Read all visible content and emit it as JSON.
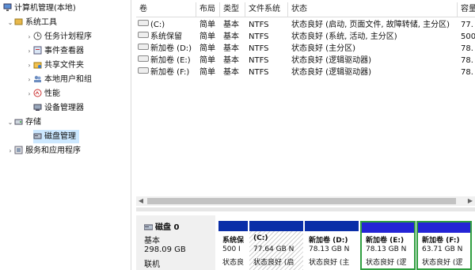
{
  "tree": {
    "root": "计算机管理(本地)",
    "system_tools": "系统工具",
    "task_scheduler": "任务计划程序",
    "event_viewer": "事件查看器",
    "shared_folders": "共享文件夹",
    "local_users": "本地用户和组",
    "performance": "性能",
    "device_manager": "设备管理器",
    "storage": "存储",
    "disk_management": "磁盘管理",
    "services_apps": "服务和应用程序"
  },
  "columns": [
    "卷",
    "布局",
    "类型",
    "文件系统",
    "状态",
    "容量"
  ],
  "volumes": [
    {
      "name": "(C:)",
      "layout": "简单",
      "type": "基本",
      "fs": "NTFS",
      "status": "状态良好 (启动, 页面文件, 故障转储, 主分区)",
      "capacity": "77."
    },
    {
      "name": "系统保留",
      "layout": "简单",
      "type": "基本",
      "fs": "NTFS",
      "status": "状态良好 (系统, 活动, 主分区)",
      "capacity": "500"
    },
    {
      "name": "新加卷 (D:)",
      "layout": "简单",
      "type": "基本",
      "fs": "NTFS",
      "status": "状态良好 (主分区)",
      "capacity": "78."
    },
    {
      "name": "新加卷 (E:)",
      "layout": "简单",
      "type": "基本",
      "fs": "NTFS",
      "status": "状态良好 (逻辑驱动器)",
      "capacity": "78."
    },
    {
      "name": "新加卷 (F:)",
      "layout": "简单",
      "type": "基本",
      "fs": "NTFS",
      "status": "状态良好 (逻辑驱动器)",
      "capacity": "78."
    }
  ],
  "disk": {
    "name": "磁盘 0",
    "type": "基本",
    "size": "298.09 GB",
    "state": "联机"
  },
  "partitions": [
    {
      "title": "系统保",
      "size": "500 I",
      "status": "状态良"
    },
    {
      "title": "(C:)",
      "size": "77.64 GB N",
      "status": "状态良好 (启"
    },
    {
      "title": "新加卷 (D:)",
      "size": "78.13 GB N",
      "status": "状态良好 (主"
    },
    {
      "title": "新加卷 (E:)",
      "size": "78.13 GB N",
      "status": "状态良好 (逻"
    },
    {
      "title": "新加卷 (F:)",
      "size": "63.71 GB N",
      "status": "状态良好 (逻"
    }
  ],
  "colors": {
    "primary_bar": "#0a2ea8",
    "logical_bar": "#2424d6",
    "logical_border": "#2f9e3f",
    "selection": "#cce8ff"
  },
  "icons": [
    "computer-icon",
    "tools-icon",
    "clock-icon",
    "event-log-icon",
    "shared-folder-icon",
    "users-icon",
    "performance-icon",
    "device-manager-icon",
    "storage-icon",
    "disk-icon",
    "services-icon",
    "volume-icon"
  ]
}
